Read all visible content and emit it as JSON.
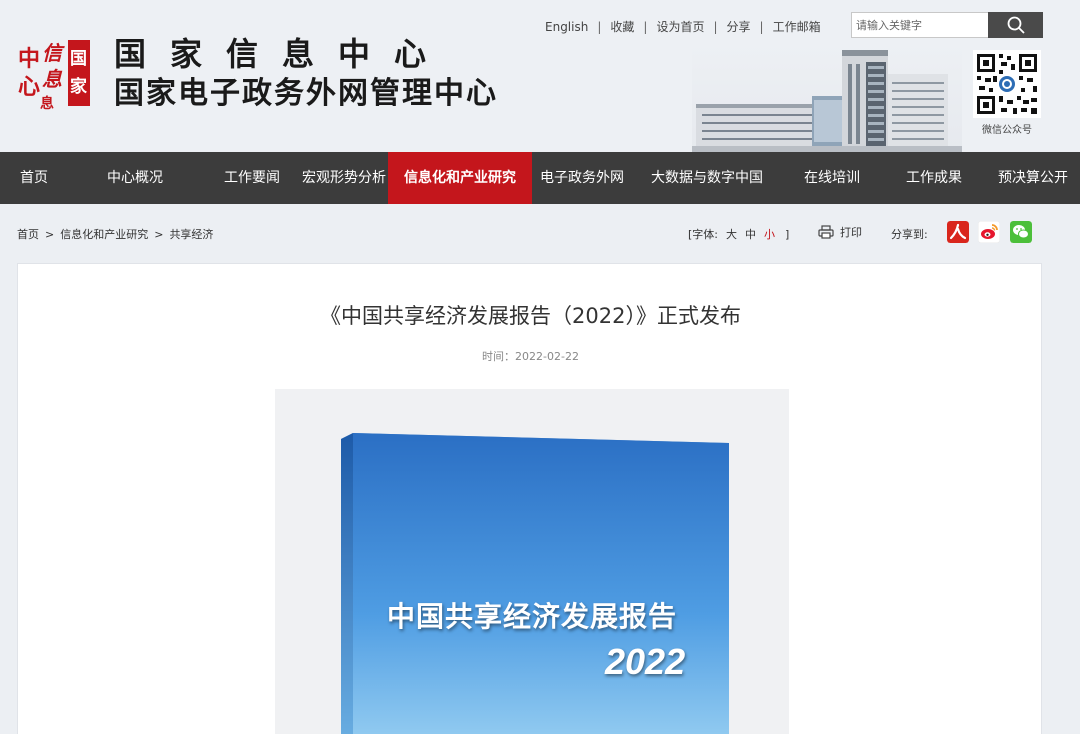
{
  "header": {
    "org_title_line1": "国家信息中心",
    "org_title_line2": "国家电子政务外网管理中心",
    "logo_seal_icon": "ndrc-seal-logo",
    "top_links": [
      "English",
      "收藏",
      "设为首页",
      "分享",
      "工作邮箱"
    ],
    "search": {
      "placeholder": "请输入关键字",
      "value": ""
    },
    "qr_label": "微信公众号"
  },
  "nav": {
    "items": [
      {
        "label": "首页",
        "active": false
      },
      {
        "label": "中心概况",
        "active": false
      },
      {
        "label": "工作要闻",
        "active": false
      },
      {
        "label": "宏观形势分析",
        "active": false
      },
      {
        "label": "信息化和产业研究",
        "active": true
      },
      {
        "label": "电子政务外网",
        "active": false
      },
      {
        "label": "大数据与数字中国",
        "active": false
      },
      {
        "label": "在线培训",
        "active": false
      },
      {
        "label": "工作成果",
        "active": false
      },
      {
        "label": "预决算公开",
        "active": false
      }
    ],
    "active_color": "#c4161c",
    "bg_color": "#3c3c3c"
  },
  "breadcrumb": {
    "items": [
      "首页",
      "信息化和产业研究",
      "共享经济"
    ],
    "separator": ">"
  },
  "font_size": {
    "label": "[字体:",
    "options": [
      "大",
      "中",
      "小"
    ],
    "selected": "小",
    "close": "]"
  },
  "print_label": "打印",
  "share": {
    "label": "分享到:",
    "icons": [
      "renren-icon",
      "weibo-icon",
      "wechat-icon"
    ]
  },
  "article": {
    "title": "《中国共享经济发展报告（2022）》正式发布",
    "date": "时间：2022-02-22",
    "cover_title": "中国共享经济发展报告",
    "cover_year": "2022"
  }
}
